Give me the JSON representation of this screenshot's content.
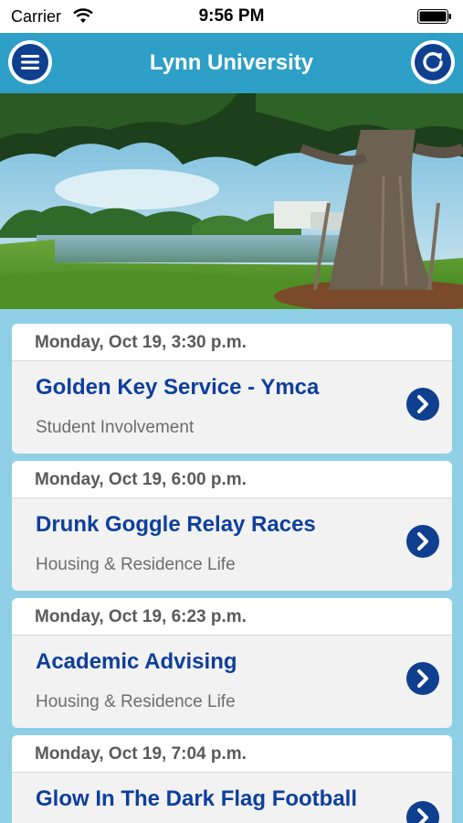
{
  "status_bar": {
    "carrier": "Carrier",
    "time": "9:56 PM"
  },
  "nav": {
    "title": "Lynn University",
    "menu_icon": "hamburger-menu-icon",
    "refresh_icon": "refresh-icon"
  },
  "colors": {
    "nav_background": "#2e9fc6",
    "page_background": "#8fd0e6",
    "title_blue": "#0e3f9c",
    "icon_navy": "#0f3f8f"
  },
  "events": [
    {
      "date": "Monday, Oct 19, 3:30 p.m.",
      "title": "Golden Key Service - Ymca",
      "category": "Student Involvement"
    },
    {
      "date": "Monday, Oct 19, 6:00 p.m.",
      "title": "Drunk Goggle Relay Races",
      "category": "Housing & Residence Life"
    },
    {
      "date": "Monday, Oct 19, 6:23 p.m.",
      "title": "Academic Advising",
      "category": "Housing & Residence Life"
    },
    {
      "date": "Monday, Oct 19, 7:04 p.m.",
      "title": "Glow In The Dark Flag Football",
      "category": ""
    }
  ]
}
